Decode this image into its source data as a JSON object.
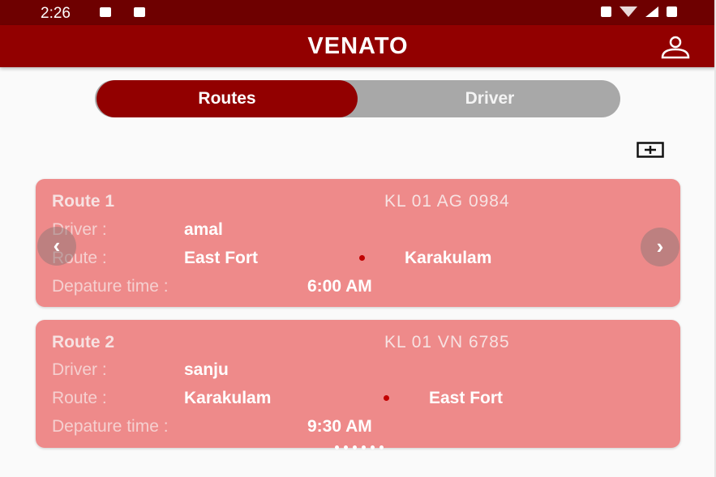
{
  "status_bar": {
    "time": "2:26",
    "left_icons": [
      "image-icon",
      "check-icon"
    ],
    "right_icons": [
      "lock-icon",
      "wifi-icon",
      "signal-icon",
      "battery-icon"
    ]
  },
  "app_bar": {
    "title": "VENATO",
    "profile_icon": "person-icon",
    "color": "#920000"
  },
  "tabs": {
    "routes": "Routes",
    "driver": "Driver",
    "active": "Routes"
  },
  "add_icon": "add-box-icon",
  "routes": [
    {
      "title": "Route 1",
      "plate": "KL 01 AG 0984",
      "driver_label": "Driver :",
      "driver": "amal",
      "route_label": "Route :",
      "from": "East Fort",
      "to": "Karakulam",
      "departure_label": "Depature time :",
      "departure": "6:00 AM"
    },
    {
      "title": "Route 2",
      "plate": "KL 01 VN 6785",
      "driver_label": "Driver :",
      "driver": "sanju",
      "route_label": "Route :",
      "from": "Karakulam",
      "to": "East Fort",
      "departure_label": "Depature time :",
      "departure": "9:30 AM"
    }
  ],
  "carousel": {
    "prev_icon": "chevron-left-icon",
    "next_icon": "chevron-right-icon",
    "prev_glyph": "‹",
    "next_glyph": "›"
  },
  "colors": {
    "accent": "#920000",
    "card": "#ee8a8a",
    "status_bar": "#6e0000"
  }
}
